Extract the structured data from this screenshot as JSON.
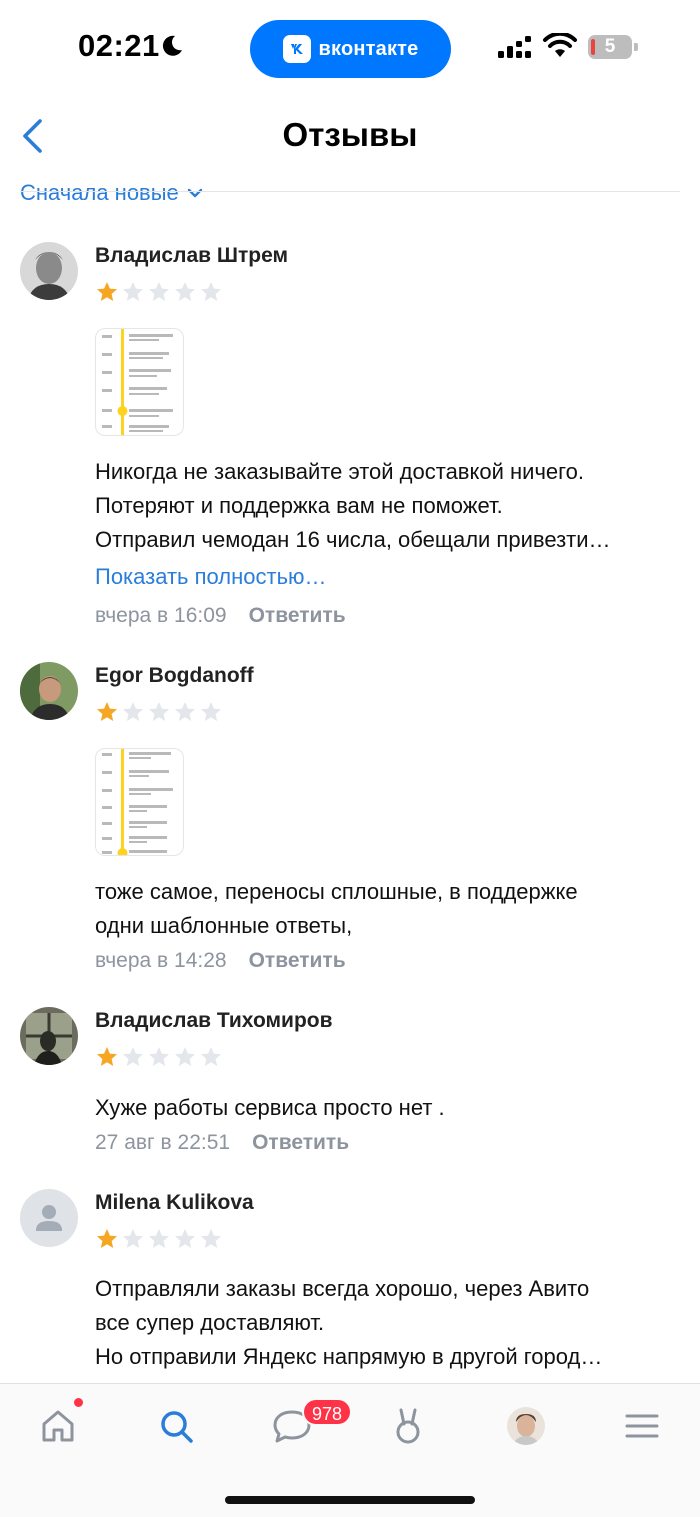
{
  "status_bar": {
    "time": "02:21",
    "app_pill_label": "вконтакте",
    "battery_level": "5"
  },
  "header": {
    "title": "Отзывы"
  },
  "sort": {
    "label": "Сначала новые"
  },
  "reviews": [
    {
      "author": "Владислав Штрем",
      "rating": 1,
      "text_lines": [
        "Никогда не заказывайте этой доставкой ничего.",
        "Потеряют и поддержка вам не поможет.",
        "Отправил чемодан 16 числа, обещали привезти…"
      ],
      "show_more": "Показать полностью…",
      "date": "вчера в 16:09",
      "reply": "Ответить"
    },
    {
      "author": "Egor Bogdanoff",
      "rating": 1,
      "text_lines": [
        "тоже самое, переносы сплошные, в поддержке",
        "одни шаблонные ответы,"
      ],
      "date": "вчера в 14:28",
      "reply": "Ответить"
    },
    {
      "author": "Владислав Тихомиров",
      "rating": 1,
      "text_lines": [
        "Хуже работы сервиса просто нет ."
      ],
      "date": "27 авг в 22:51",
      "reply": "Ответить"
    },
    {
      "author": "Milena Kulikova",
      "rating": 1,
      "text_lines": [
        "Отправляли заказы всегда хорошо, через Авито",
        "все супер доставляют.",
        "Но отправили Яндекс напрямую в другой город…"
      ]
    }
  ],
  "tabbar": {
    "messages_badge": "978"
  },
  "colors": {
    "accent": "#2a7dd8",
    "vk_blue": "#0077ff",
    "star_filled": "#f5a623",
    "star_empty": "#e3e6ea",
    "badge": "#ff3347",
    "timeline_yellow": "#ffd21f"
  },
  "icons": [
    "moon-icon",
    "vk-logo-icon",
    "signal-icon",
    "wifi-icon",
    "battery-icon",
    "back-chevron-icon",
    "chevron-down-icon",
    "star-icon",
    "home-icon",
    "search-icon",
    "messages-icon",
    "clips-icon",
    "profile-avatar",
    "menu-icon"
  ]
}
